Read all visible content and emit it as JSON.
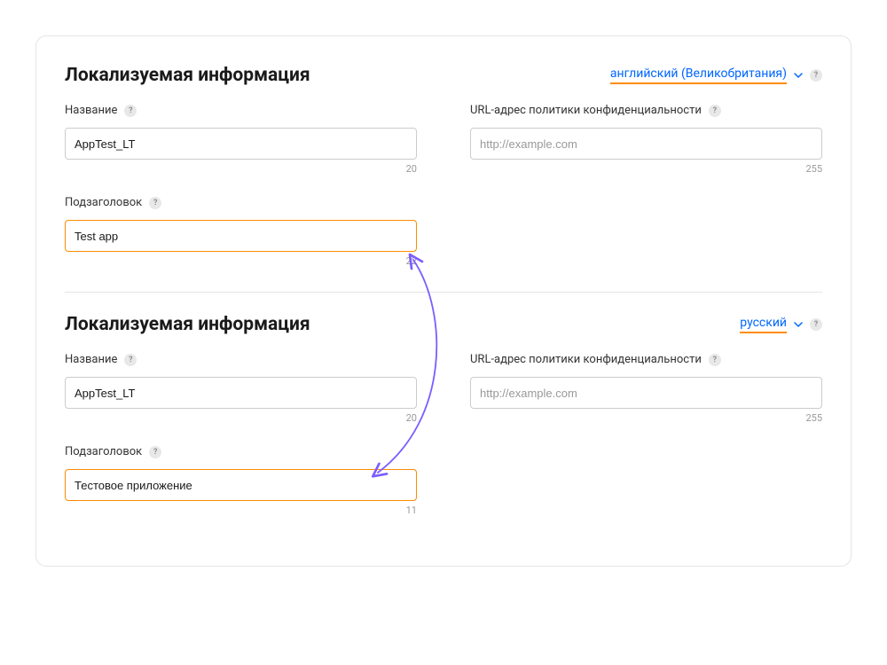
{
  "sections": [
    {
      "title": "Локализуемая информация",
      "language": "английский (Великобритания)",
      "name": {
        "label": "Название",
        "value": "AppTest_LT",
        "limit": "20"
      },
      "privacy_url": {
        "label": "URL-адрес политики конфиденциальности",
        "placeholder": "http://example.com",
        "value": "",
        "limit": "255"
      },
      "subtitle": {
        "label": "Подзаголовок",
        "value": "Test app",
        "limit": "22"
      }
    },
    {
      "title": "Локализуемая информация",
      "language": "русский",
      "name": {
        "label": "Название",
        "value": "AppTest_LT",
        "limit": "20"
      },
      "privacy_url": {
        "label": "URL-адрес политики конфиденциальности",
        "placeholder": "http://example.com",
        "value": "",
        "limit": "255"
      },
      "subtitle": {
        "label": "Подзаголовок",
        "value": "Тестовое приложение",
        "limit": "11"
      }
    }
  ],
  "help_glyph": "?"
}
